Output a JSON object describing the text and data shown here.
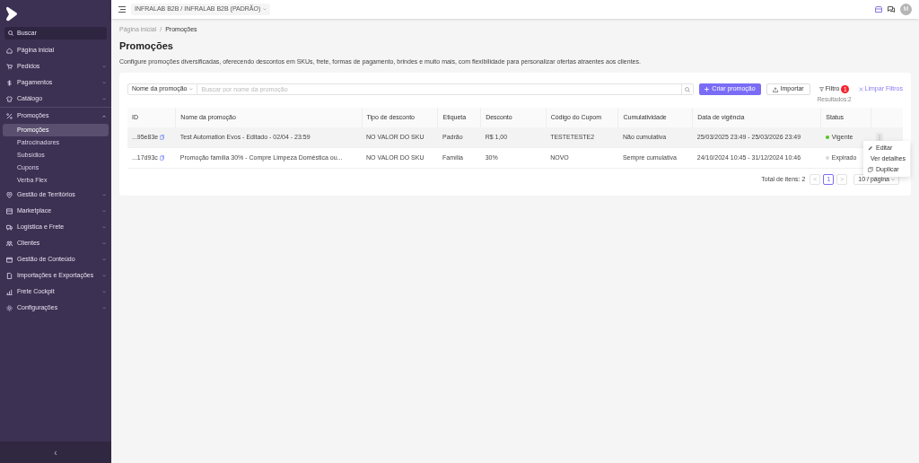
{
  "sidebar": {
    "search": {
      "placeholder": "Buscar"
    },
    "items": [
      {
        "label": "Página inicial",
        "kind": "link",
        "expanded": false
      },
      {
        "label": "Pedidos",
        "kind": "group",
        "expanded": false
      },
      {
        "label": "Pagamentos",
        "kind": "group",
        "expanded": false
      },
      {
        "label": "Catálogo",
        "kind": "group",
        "expanded": false
      },
      {
        "label": "Promoções",
        "kind": "group",
        "expanded": true,
        "children": [
          {
            "label": "Promoções",
            "selected": true
          },
          {
            "label": "Patrocinadores",
            "selected": false
          },
          {
            "label": "Subsídios",
            "selected": false
          },
          {
            "label": "Cupons",
            "selected": false
          },
          {
            "label": "Verba Flex",
            "selected": false
          }
        ]
      },
      {
        "label": "Gestão de Territórios",
        "kind": "group",
        "expanded": false
      },
      {
        "label": "Marketplace",
        "kind": "group",
        "expanded": false
      },
      {
        "label": "Logística e Frete",
        "kind": "group",
        "expanded": false
      },
      {
        "label": "Clientes",
        "kind": "group",
        "expanded": false
      },
      {
        "label": "Gestão de Conteúdo",
        "kind": "group",
        "expanded": false
      },
      {
        "label": "Importações e Exportações",
        "kind": "group",
        "expanded": false
      },
      {
        "label": "Frete Cockpit",
        "kind": "group",
        "expanded": false
      },
      {
        "label": "Configurações",
        "kind": "group",
        "expanded": false
      }
    ],
    "collapse": "‹"
  },
  "topbar": {
    "tenant": "INFRALAB B2B / INFRALAB B2B (PADRÃO)",
    "avatar": "M"
  },
  "breadcrumb": {
    "items": [
      "Página inicial",
      "Promoções"
    ],
    "separator": "/"
  },
  "page": {
    "title": "Promoções",
    "description": "Configure promoções diversificadas, oferecendo descontos em SKUs, frete, formas de pagamento, brindes e muito mais, com flexibilidade para personalizar ofertas atraentes aos clientes."
  },
  "toolbar": {
    "search_field": "Nome da promoção",
    "placeholder": "Buscar por nome da promoção",
    "create": "Criar promoção",
    "import": "Importar",
    "filter": "Filtro",
    "filter_count": "1",
    "results": "Resultados:2",
    "clear": "Limpar Filtros"
  },
  "table": {
    "columns": [
      "ID",
      "Nome da promoção",
      "Tipo de desconto",
      "Etiqueta",
      "Desconto",
      "Código do Cupom",
      "Cumulatividade",
      "Data de vigência",
      "Status"
    ],
    "rows": [
      {
        "cells": [
          "...95e83e",
          "Test Automation Evos - Editado - 02/04 - 23:59",
          "NO VALOR DO SKU",
          "Padrão",
          "R$ 1,00",
          "TESTETESTE2",
          "Não cumulativa",
          "25/03/2025 23:49 - 25/03/2026 23:49"
        ],
        "status": "Vigente",
        "color": "#52c41a",
        "selected": true
      },
      {
        "cells": [
          "...17d93c",
          "Promoção família 30% - Compre Limpeza Doméstica ou...",
          "NO VALOR DO SKU",
          "Família",
          "30%",
          "NOVO",
          "Sempre cumulativa",
          "24/10/2024 10:45 - 31/12/2024 10:46"
        ],
        "status": "Expirado",
        "color": "#d9d9d9",
        "selected": false
      }
    ]
  },
  "row_menu": [
    "Editar",
    "Ver detalhes",
    "Duplicar"
  ],
  "pagination": {
    "total": "Total de itens: 2",
    "prev": "<",
    "pages": [
      {
        "label": "1",
        "selected": true
      }
    ],
    "next": ">",
    "page_size": "10 / página"
  }
}
